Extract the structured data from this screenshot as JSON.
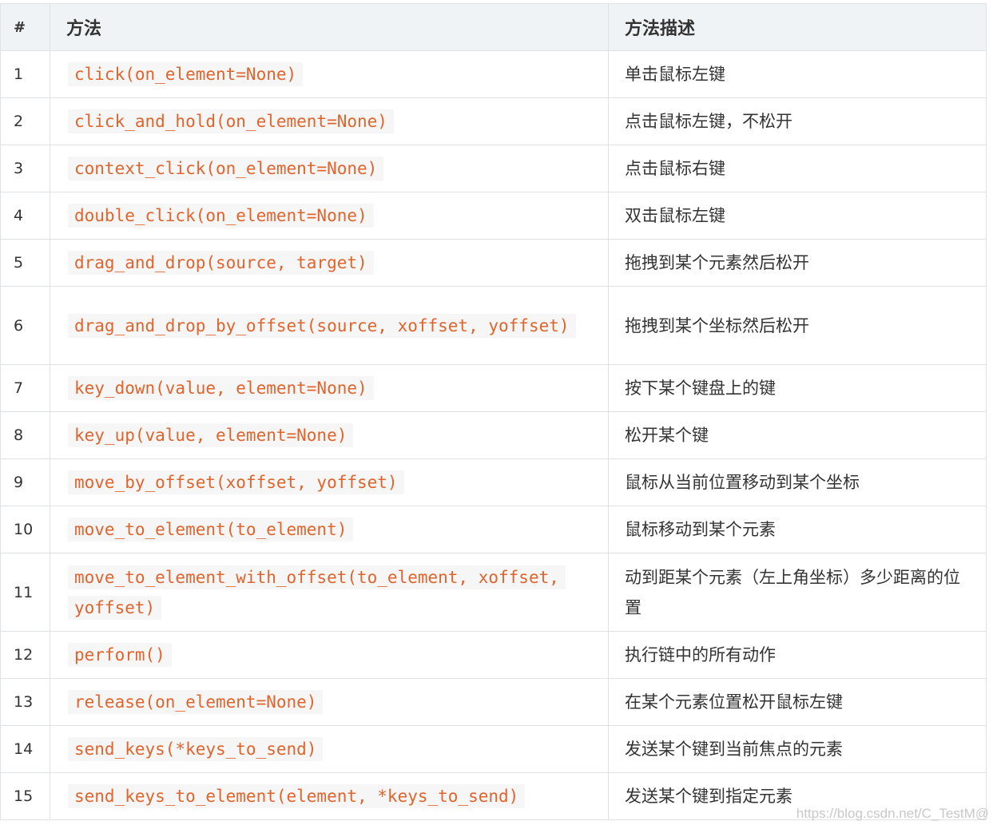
{
  "table": {
    "headers": [
      "#",
      "方法",
      "方法描述"
    ],
    "rows": [
      {
        "num": "1",
        "method": "click(on_element=None)",
        "desc": "单击鼠标左键"
      },
      {
        "num": "2",
        "method": "click_and_hold(on_element=None)",
        "desc": "点击鼠标左键，不松开"
      },
      {
        "num": "3",
        "method": "context_click(on_element=None)",
        "desc": "点击鼠标右键"
      },
      {
        "num": "4",
        "method": "double_click(on_element=None)",
        "desc": "双击鼠标左键"
      },
      {
        "num": "5",
        "method": "drag_and_drop(source, target)",
        "desc": "拖拽到某个元素然后松开"
      },
      {
        "num": "6",
        "method": "drag_and_drop_by_offset(source, xoffset, yoffset)",
        "desc": "拖拽到某个坐标然后松开"
      },
      {
        "num": "7",
        "method": "key_down(value, element=None)",
        "desc": "按下某个键盘上的键"
      },
      {
        "num": "8",
        "method": "key_up(value, element=None)",
        "desc": "松开某个键"
      },
      {
        "num": "9",
        "method": "move_by_offset(xoffset, yoffset)",
        "desc": "鼠标从当前位置移动到某个坐标"
      },
      {
        "num": "10",
        "method": "move_to_element(to_element)",
        "desc": "鼠标移动到某个元素"
      },
      {
        "num": "11",
        "method": "move_to_element_with_offset(to_element, xoffset, yoffset)",
        "desc": "动到距某个元素（左上角坐标）多少距离的位置"
      },
      {
        "num": "12",
        "method": "perform()",
        "desc": "执行链中的所有动作"
      },
      {
        "num": "13",
        "method": "release(on_element=None)",
        "desc": "在某个元素位置松开鼠标左键"
      },
      {
        "num": "14",
        "method": "send_keys(*keys_to_send)",
        "desc": "发送某个键到当前焦点的元素"
      },
      {
        "num": "15",
        "method": "send_keys_to_element(element, *keys_to_send)",
        "desc": "发送某个键到指定元素"
      }
    ]
  },
  "watermark": "https://blog.csdn.net/C_TestM@"
}
